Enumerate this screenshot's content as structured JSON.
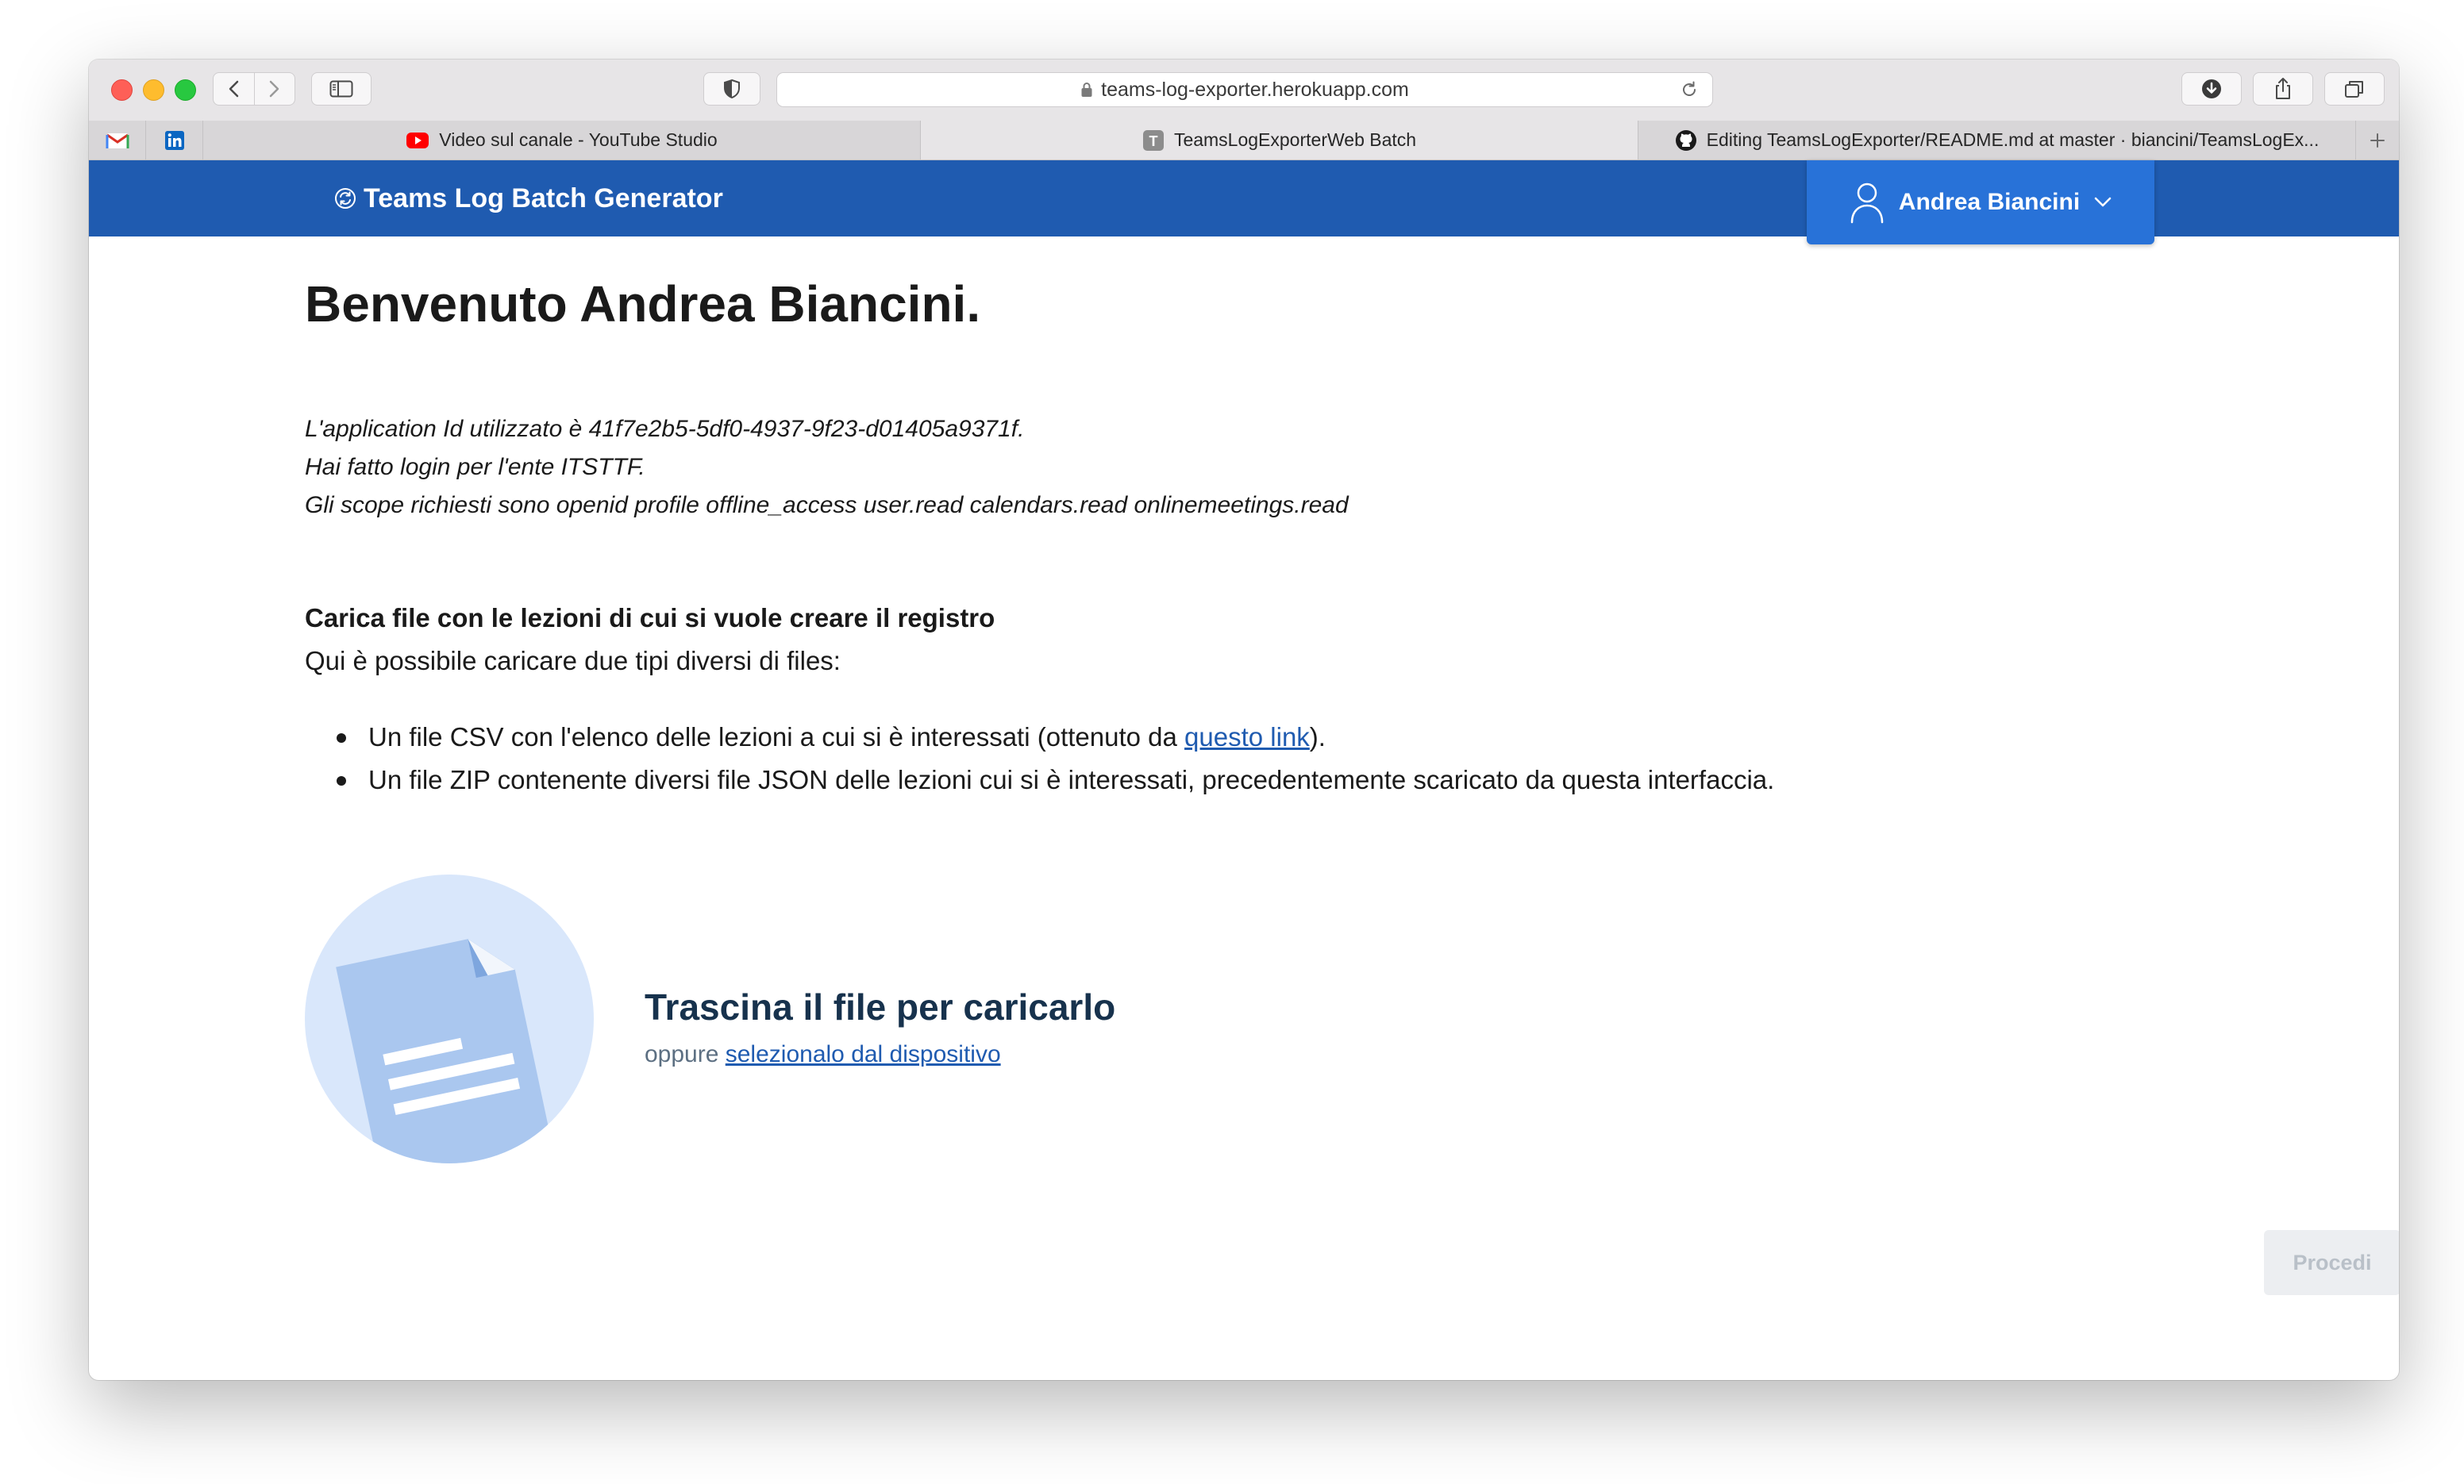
{
  "browser": {
    "url": "teams-log-exporter.herokuapp.com",
    "tabs": [
      {
        "label": "Video sul canale - YouTube Studio",
        "icon": "youtube-icon"
      },
      {
        "label": "TeamsLogExporterWeb Batch",
        "icon": "t-letter-icon"
      },
      {
        "label": "Editing TeamsLogExporter/README.md at master · biancini/TeamsLogEx...",
        "icon": "github-icon"
      }
    ],
    "pinned_tabs": [
      "gmail-icon",
      "linkedin-icon"
    ]
  },
  "app": {
    "brand": "Teams Log Batch Generator",
    "user_name": "Andrea Biancini",
    "colors": {
      "nav_bg": "#1f5bb0",
      "user_menu_bg": "#2872d8",
      "link": "#1f5bb0"
    }
  },
  "main": {
    "title": "Benvenuto Andrea Biancini.",
    "info_app_id": "L'application Id utilizzato è 41f7e2b5-5df0-4937-9f23-d01405a9371f.",
    "info_login": "Hai fatto login per l'ente ITSTTF.",
    "info_scopes": "Gli scope richiesti sono openid profile offline_access user.read calendars.read onlinemeetings.read",
    "upload_title": "Carica file con le lezioni di cui si vuole creare il registro",
    "upload_desc": "Qui è possibile caricare due tipi diversi di files:",
    "bullet1_prefix": "Un file CSV con l'elenco delle lezioni a cui si è interessati (ottenuto da ",
    "bullet1_link": "questo link",
    "bullet1_suffix": ").",
    "bullet2": "Un file ZIP contenente diversi file JSON delle lezioni cui si è interessati, precedentemente scaricato da questa interfaccia.",
    "drop_title": "Trascina il file per caricarlo",
    "drop_or": "oppure ",
    "drop_link": "selezionalo dal dispositivo",
    "proceed": "Procedi"
  }
}
